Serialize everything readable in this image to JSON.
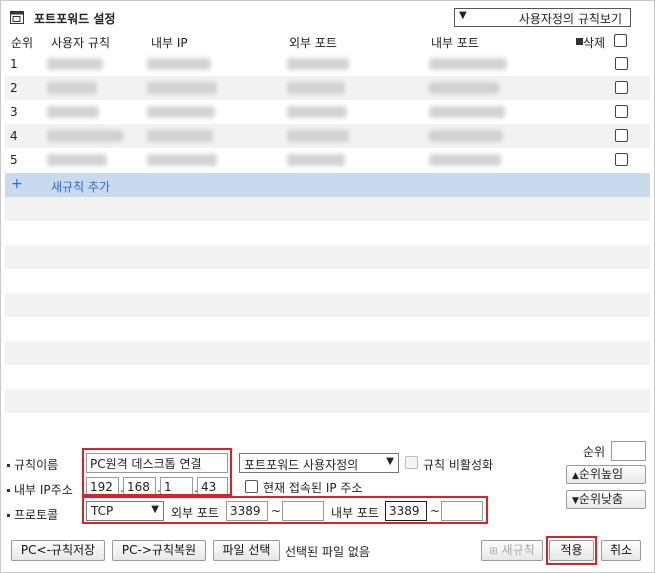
{
  "title": "포트포워드 설정",
  "view_select": "사용자정의 규칙보기",
  "table": {
    "headers": {
      "order": "순위",
      "rule": "사용자 규칙",
      "internal_ip": "내부 IP",
      "external_port": "외부 포트",
      "internal_port": "내부 포트",
      "delete": "삭제"
    },
    "rows": [
      {
        "num": "1"
      },
      {
        "num": "2"
      },
      {
        "num": "3"
      },
      {
        "num": "4"
      },
      {
        "num": "5"
      }
    ],
    "add_rule": "새규칙 추가"
  },
  "form": {
    "rule_name_label": "규칙이름",
    "rule_name_value": "PC원격 데스크톱 연결",
    "rule_type": "포트포워드 사용자정의",
    "disable_rule_label": "규칙 비활성화",
    "internal_ip_label": "내부 IP주소",
    "ip": [
      "192",
      "168",
      "1",
      "43"
    ],
    "current_ip_label": "현재 접속된 IP 주소",
    "protocol_label": "프로토콜",
    "protocol_value": "TCP",
    "external_port_label": "외부 포트",
    "external_port_from": "3389",
    "external_port_to": "",
    "internal_port_label": "내부 포트",
    "internal_port_from": "3389",
    "internal_port_to": "",
    "tilde": "~",
    "order_label": "순위",
    "order_value": "",
    "raise_label": "순위높임",
    "lower_label": "순위낮춤"
  },
  "footer": {
    "save_to_pc": "PC<-규칙저장",
    "restore_from_pc": "PC->규칙복원",
    "file_select": "파일 선택",
    "no_file": "선택된 파일 없음",
    "new_rule": "새규칙",
    "apply": "적용",
    "cancel": "취소"
  },
  "colors": {
    "accent_blue": "#2b6cd6",
    "add_row_bg": "#c9d9ee",
    "highlight_red": "#d9222a"
  }
}
